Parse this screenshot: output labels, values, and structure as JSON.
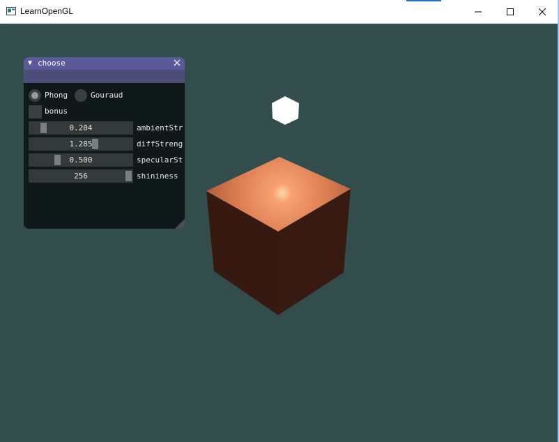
{
  "window": {
    "title": "LearnOpenGL",
    "minimize_icon": "minimize-icon",
    "maximize_icon": "maximize-icon",
    "close_icon": "close-icon"
  },
  "colors": {
    "viewport_bg": "#334d4d",
    "panel_title": "#5a5a9a",
    "cube_light": "#ffffff",
    "cube_object": "#d0704a"
  },
  "panel": {
    "title": "choose",
    "collapse_icon": "triangle-down-icon",
    "close_icon": "close-icon",
    "shading": {
      "options": [
        "Phong",
        "Gouraud"
      ],
      "selected": "Phong"
    },
    "bonus": {
      "label": "bonus",
      "checked": false
    },
    "sliders": [
      {
        "label": "ambientStr",
        "value": "0.204",
        "fraction": 0.13
      },
      {
        "label": "diffStreng",
        "value": "1.285",
        "fraction": 0.65
      },
      {
        "label": "specularSt",
        "value": "0.500",
        "fraction": 0.27
      },
      {
        "label": "shininess",
        "value": "256",
        "fraction": 1.0
      }
    ]
  }
}
